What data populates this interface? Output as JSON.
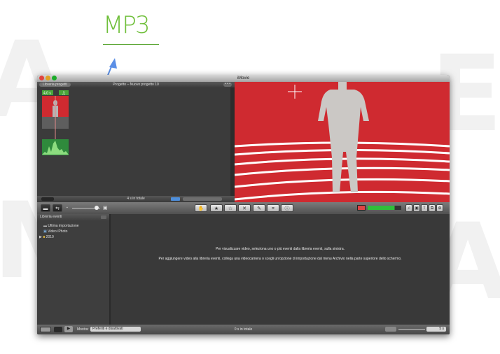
{
  "annotation": {
    "title": "MP3"
  },
  "window": {
    "title": "iMovie"
  },
  "project_library": {
    "library_button": "Libreria progetti",
    "project_title": "Progetto – Nuovo progetto 10",
    "more_button": "• • •",
    "total_label": "4 s in totale"
  },
  "event_library": {
    "header": "Libreria eventi",
    "items": [
      {
        "label": "Ultima importazione",
        "icon": "film-icon"
      },
      {
        "label": "Video iPhoto",
        "icon": "photo-icon"
      },
      {
        "label": "2010",
        "icon": "folder-icon"
      }
    ]
  },
  "event_browser": {
    "message_1": "Per visualizzare video, seleziona uno o più eventi dalla libreria eventi, sulla sinistra.",
    "message_2": "Per aggiungere video alla libreria eventi, collega una videocamera o scegli un'opzione di importazione dal menu Archivio nella parte superiore dello schermo."
  },
  "bottom_bar": {
    "show_label": "Mostra:",
    "filter_value": "Preferiti e disattivati",
    "total_label": "0 s in totale",
    "duration_value": "5 s"
  },
  "colors": {
    "annotation_green": "#6fbf3a",
    "arrow_blue": "#5b8fe6",
    "viewer_red": "#cf2a30"
  }
}
